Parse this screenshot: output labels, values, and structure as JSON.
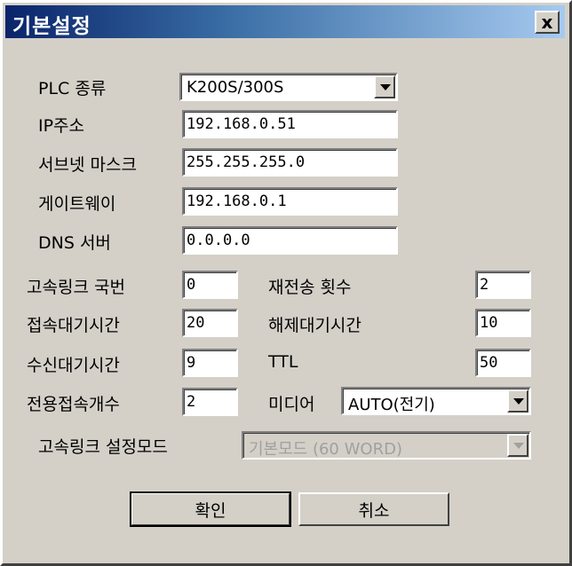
{
  "window": {
    "title": "기본설정",
    "close_symbol": "x"
  },
  "fields": {
    "plc_type": {
      "label": "PLC 종류",
      "value": "K200S/300S"
    },
    "ip": {
      "label": "IP주소",
      "value": "192.168.0.51"
    },
    "subnet": {
      "label": "서브넷 마스크",
      "value": "255.255.255.0"
    },
    "gateway": {
      "label": "게이트웨이",
      "value": "192.168.0.1"
    },
    "dns": {
      "label": "DNS 서버",
      "value": "0.0.0.0"
    },
    "hs_station": {
      "label": "고속링크 국번",
      "value": "0"
    },
    "retransmit": {
      "label": "재전송 횟수",
      "value": "2"
    },
    "conn_wait": {
      "label": "접속대기시간",
      "value": "20"
    },
    "release_wait": {
      "label": "해제대기시간",
      "value": "10"
    },
    "recv_wait": {
      "label": "수신대기시간",
      "value": "9"
    },
    "ttl": {
      "label": "TTL",
      "value": "50"
    },
    "dedicated_conn": {
      "label": "전용접속개수",
      "value": "2"
    },
    "media": {
      "label": "미디어",
      "value": "AUTO(전기)"
    },
    "hs_mode": {
      "label": "고속링크 설정모드",
      "value": "기본모드 (60 WORD)"
    }
  },
  "buttons": {
    "ok": "확인",
    "cancel": "취소"
  },
  "icons": {
    "close": "close-icon",
    "dropdown": "chevron-down-icon"
  },
  "colors": {
    "title_start": "#0a246a",
    "title_end": "#a6caf0",
    "face": "#d4d0c8"
  }
}
